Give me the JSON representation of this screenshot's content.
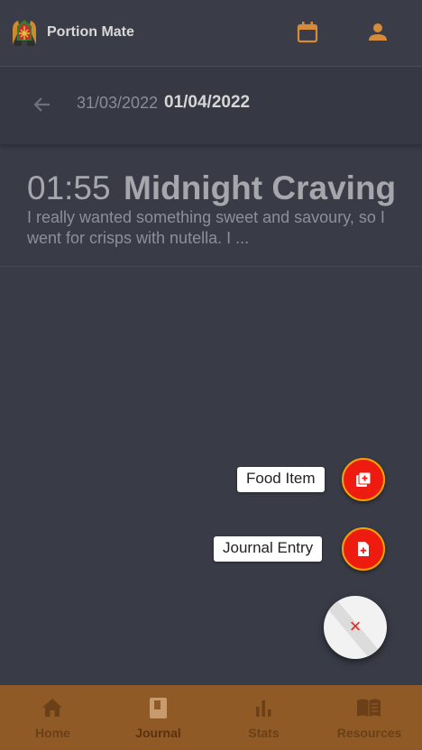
{
  "header": {
    "title": "Portion Mate",
    "icons": [
      "calendar-icon",
      "person-icon"
    ],
    "accent": "#d58b3c"
  },
  "datebar": {
    "prev_date": "31/03/2022",
    "current_date": "01/04/2022"
  },
  "entries": [
    {
      "time": "01:55",
      "title": "Midnight Craving",
      "text": "I really wanted something sweet and savoury, so I went for crisps with nutella. I ..."
    }
  ],
  "fab": {
    "food_item_label": "Food Item",
    "journal_entry_label": "Journal Entry",
    "close_symbol": "×",
    "color": "#ee1c10"
  },
  "nav": {
    "items": [
      {
        "label": "Home",
        "icon": "home-icon"
      },
      {
        "label": "Journal",
        "icon": "journal-icon"
      },
      {
        "label": "Stats",
        "icon": "stats-icon"
      },
      {
        "label": "Resources",
        "icon": "book-icon"
      }
    ],
    "active": "Journal",
    "background": "#8f5a25"
  }
}
